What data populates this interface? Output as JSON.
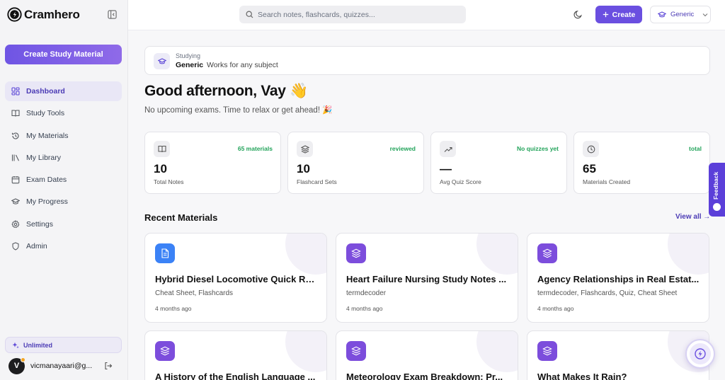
{
  "app": {
    "name": "Cramhero"
  },
  "sidebar": {
    "create_label": "Create Study Material",
    "items": [
      {
        "label": "Dashboard",
        "icon": "dashboard-icon",
        "active": true
      },
      {
        "label": "Study Tools",
        "icon": "book-icon",
        "active": false
      },
      {
        "label": "My Materials",
        "icon": "history-icon",
        "active": false
      },
      {
        "label": "My Library",
        "icon": "library-icon",
        "active": false
      },
      {
        "label": "Exam Dates",
        "icon": "calendar-icon",
        "active": false
      },
      {
        "label": "My Progress",
        "icon": "graduation-cap-icon",
        "active": false
      },
      {
        "label": "Settings",
        "icon": "gear-icon",
        "active": false
      },
      {
        "label": "Admin",
        "icon": "shield-icon",
        "active": false
      }
    ],
    "plan_label": "Unlimited",
    "user": {
      "initial": "V",
      "email": "vicmanayaari@g..."
    }
  },
  "topbar": {
    "search_placeholder": "Search notes, flashcards, quizzes...",
    "create_label": "Create",
    "subject_label": "Generic"
  },
  "studying": {
    "label": "Studying",
    "subject": "Generic",
    "description": "Works for any subject"
  },
  "greeting": {
    "title": "Good afternoon, Vay 👋",
    "subtitle": "No upcoming exams. Time to relax or get ahead! 🎉"
  },
  "stats": [
    {
      "value": "10",
      "label": "Total Notes",
      "badge": "65 materials",
      "icon": "book-open-icon"
    },
    {
      "value": "10",
      "label": "Flashcard Sets",
      "badge": "reviewed",
      "icon": "layers-icon"
    },
    {
      "value": "—",
      "label": "Avg Quiz Score",
      "badge": "No quizzes yet",
      "icon": "trending-up-icon"
    },
    {
      "value": "65",
      "label": "Materials Created",
      "badge": "total",
      "icon": "clock-icon"
    }
  ],
  "recent": {
    "title": "Recent Materials",
    "view_all": "View all →",
    "items": [
      {
        "title": "Hybrid Diesel Locomotive Quick Re...",
        "tags": "Cheat Sheet, Flashcards",
        "time": "4 months ago",
        "icon": "document-icon",
        "color": "#3b82f6"
      },
      {
        "title": "Heart Failure Nursing Study Notes ...",
        "tags": "termdecoder",
        "time": "4 months ago",
        "icon": "layers-icon",
        "color": "#7c4ddc"
      },
      {
        "title": "Agency Relationships in Real Estat...",
        "tags": "termdecoder, Flashcards, Quiz, Cheat Sheet",
        "time": "4 months ago",
        "icon": "layers-icon",
        "color": "#7c4ddc"
      },
      {
        "title": "A History of the English Language ...",
        "tags": "",
        "time": "",
        "icon": "layers-icon",
        "color": "#7c4ddc"
      },
      {
        "title": "Meteorology Exam Breakdown: Pr...",
        "tags": "",
        "time": "",
        "icon": "layers-icon",
        "color": "#7c4ddc"
      },
      {
        "title": "What Makes It Rain?",
        "tags": "",
        "time": "",
        "icon": "layers-icon",
        "color": "#7c4ddc"
      }
    ]
  },
  "feedback_label": "Feedback",
  "colors": {
    "accent": "#6a4fe0",
    "success": "#22a35a"
  }
}
